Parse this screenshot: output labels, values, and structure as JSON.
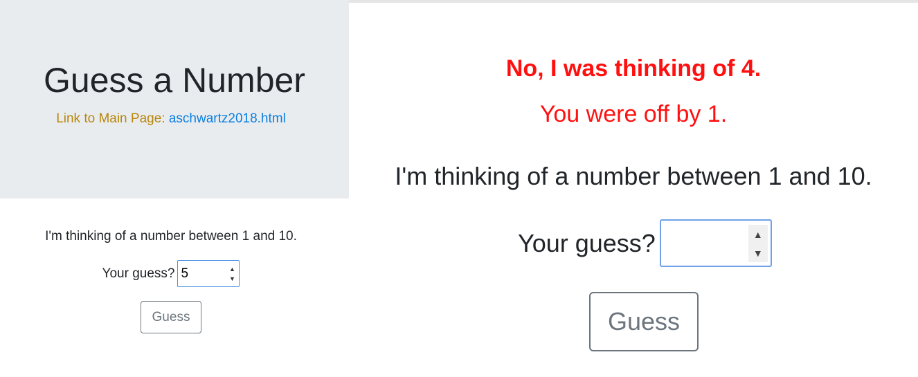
{
  "header": {
    "title": "Guess a Number",
    "link_prefix": "Link to Main Page: ",
    "link_text": "aschwartz2018.html"
  },
  "left_form": {
    "prompt": "I'm thinking of a number between 1 and 10.",
    "guess_label": "Your guess?",
    "guess_value": "5",
    "button_label": "Guess"
  },
  "right_view": {
    "result_line_1": "No, I was thinking of 4.",
    "result_line_2": "You were off by 1.",
    "prompt": "I'm thinking of a number between 1 and 10.",
    "guess_label": "Your guess?",
    "guess_value": "",
    "button_label": "Guess"
  },
  "colors": {
    "jumbotron_bg": "#e9ecef",
    "link_prefix": "#b8860b",
    "link": "#0b7fe0",
    "result_text": "#ff1010"
  }
}
